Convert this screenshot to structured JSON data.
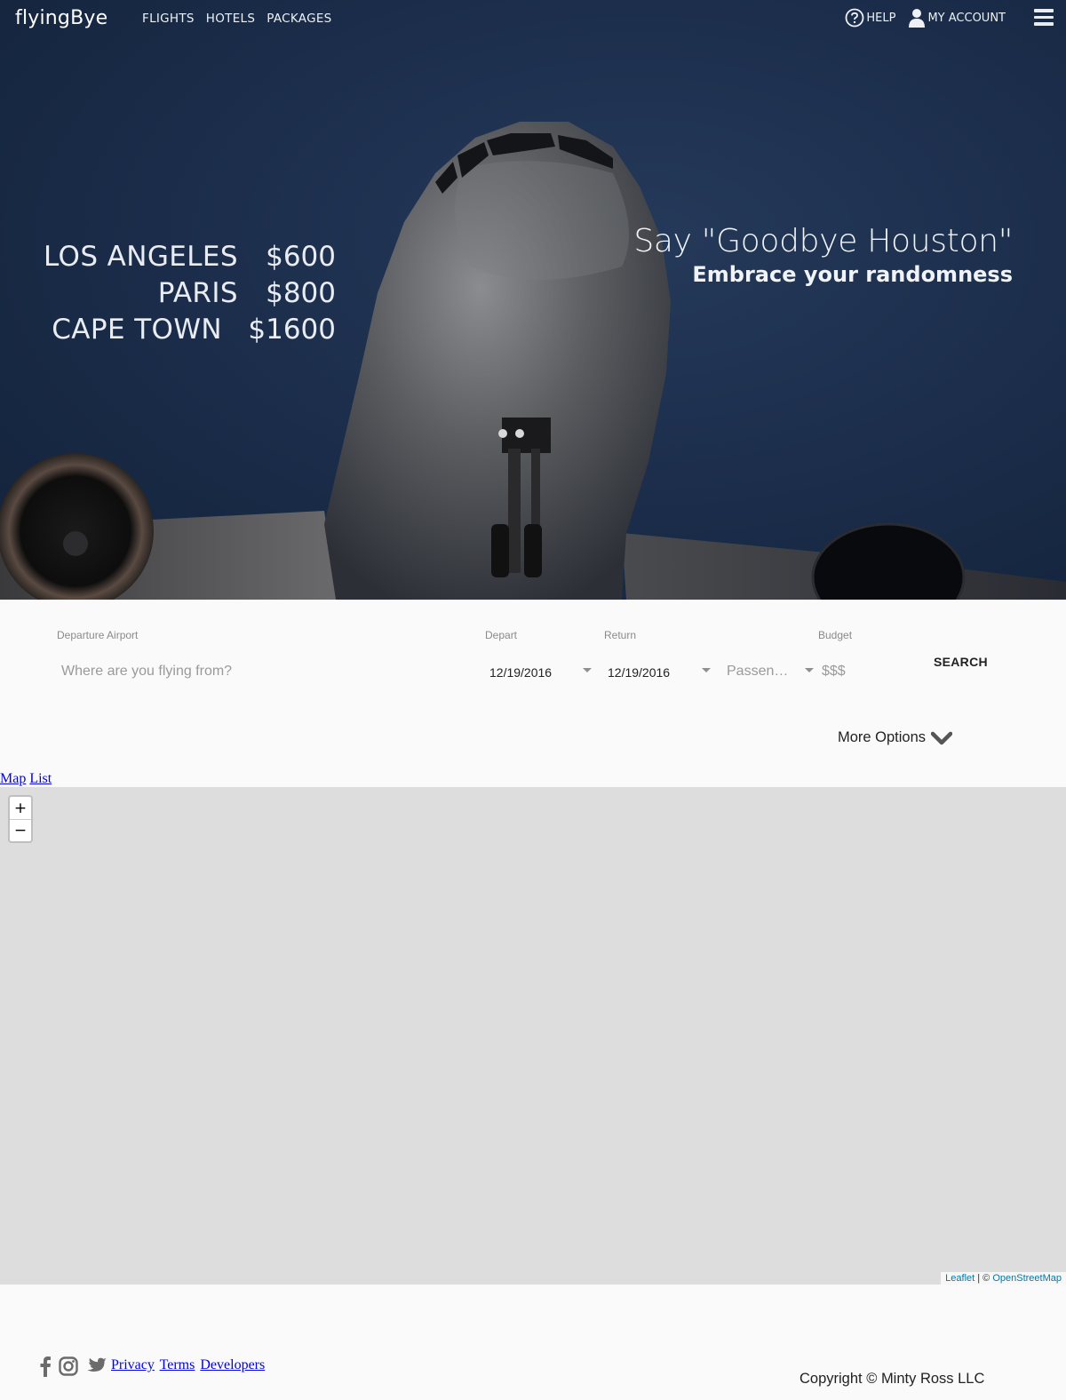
{
  "header": {
    "logo": "flyingBye",
    "nav": [
      "FLIGHTS",
      "HOTELS",
      "PACKAGES"
    ],
    "help": "HELP",
    "account": "MY ACCOUNT",
    "menu_icon": "hamburger-icon"
  },
  "hero": {
    "deals": [
      {
        "city": "LOS ANGELES",
        "price": "$600"
      },
      {
        "city": "PARIS",
        "price": "$800"
      },
      {
        "city": "CAPE TOWN",
        "price": "$1600"
      }
    ],
    "tagline": "Say \"Goodbye Houston\"",
    "subtagline": "Embrace your randomness"
  },
  "search": {
    "departure_label": "Departure Airport",
    "departure_placeholder": "Where are you flying from?",
    "depart_label": "Depart",
    "depart_value": "12/19/2016",
    "return_label": "Return",
    "return_value": "12/19/2016",
    "passengers_placeholder": "Passen…",
    "budget_label": "Budget",
    "budget_placeholder": "$$$",
    "search_button": "SEARCH",
    "more_options": "More Options"
  },
  "view_tabs": {
    "map": "Map",
    "list": "List"
  },
  "map": {
    "zoom_in": "+",
    "zoom_out": "−",
    "attribution_leaflet": "Leaflet",
    "attribution_sep": " | © ",
    "attribution_osm": "OpenStreetMap"
  },
  "footer": {
    "links": [
      "Privacy",
      "Terms",
      "Developers"
    ],
    "copyright": "Copyright © Minty Ross LLC",
    "social_icons": [
      "facebook-icon",
      "instagram-icon",
      "twitter-icon"
    ]
  },
  "colors": {
    "hero_bg": "#1a2c49",
    "link": "#0000ee",
    "map_bg": "#dddddd",
    "attribution_link": "#0078a8"
  }
}
